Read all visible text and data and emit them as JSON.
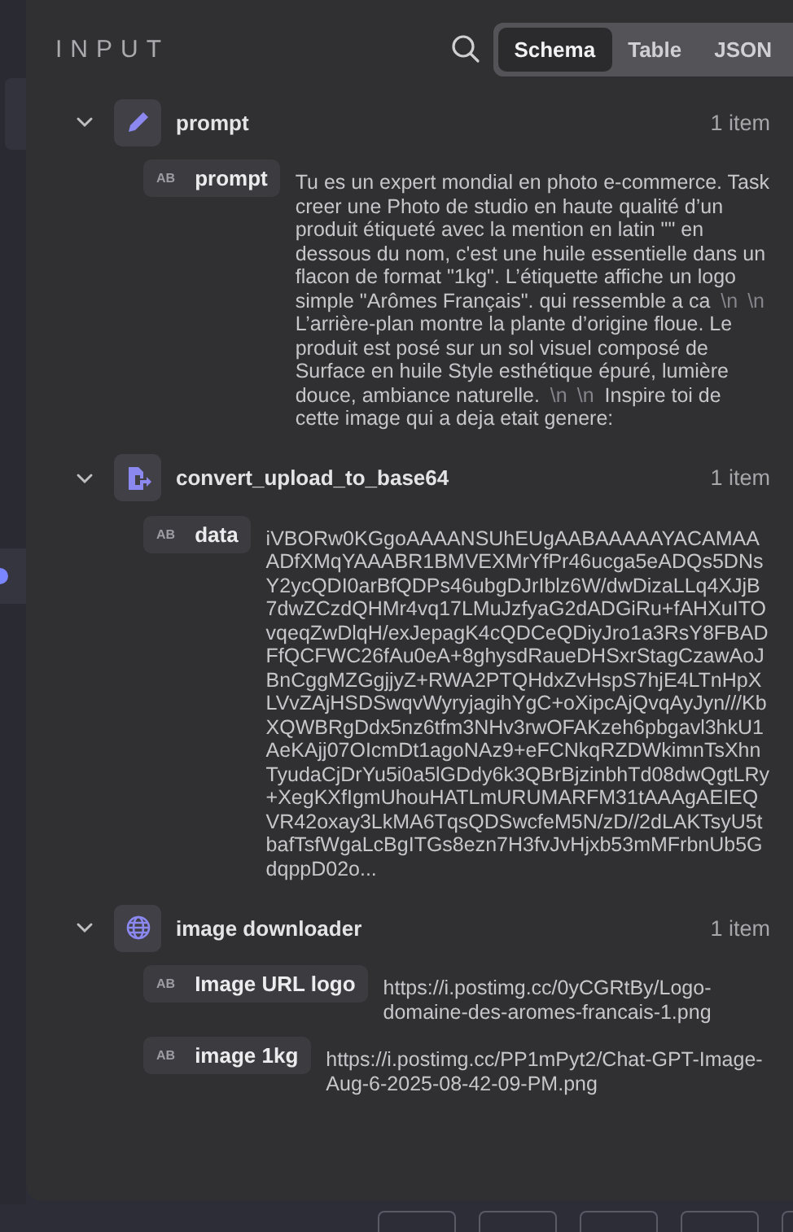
{
  "panel": {
    "title": "INPUT"
  },
  "view_tabs": [
    {
      "label": "Schema",
      "selected": true
    },
    {
      "label": "Table",
      "selected": false
    },
    {
      "label": "JSON",
      "selected": false
    }
  ],
  "nodes": [
    {
      "name": "prompt",
      "expanded": true,
      "count": "1 item",
      "fields": [
        {
          "badge": "AB",
          "name": "prompt",
          "value": [
            {
              "kind": "text",
              "text": "Tu es un expert mondial en photo e-commerce. Task creer une Photo de studio en haute qualité d’un produit étiqueté avec la mention en latin \"\" en dessous du nom, c'est une huile essentielle dans un flacon de format \"1kg\". L’étiquette affiche un logo simple \"Arômes Français\". qui ressemble a ca "
            },
            {
              "kind": "escape",
              "text": "\\n"
            },
            {
              "kind": "escape",
              "text": "\\n"
            },
            {
              "kind": "text",
              "text": " L’arrière-plan montre la plante d’origine floue. Le produit est posé sur un sol visuel composé de Surface en huile Style esthétique épuré, lumière douce, ambiance naturelle. "
            },
            {
              "kind": "escape",
              "text": "\\n"
            },
            {
              "kind": "escape",
              "text": "\\n"
            },
            {
              "kind": "text",
              "text": " Inspire toi de cette image qui a deja etait genere:"
            }
          ]
        }
      ]
    },
    {
      "name": "convert_upload_to_base64",
      "expanded": true,
      "count": "1 item",
      "fields": [
        {
          "badge": "AB",
          "name": "data",
          "value": [
            {
              "kind": "text",
              "text": "iVBORw0KGgoAAAANSUhEUgAABAAAAAYACAMAAADfXMqYAAABR1BMVEXMrYfPr46ucga5eADQs5DNsY2ycQDI0arBfQDPs46ubgDJrIblz6W/dwDizaLLq4XJjB7dwZCzdQHMr4vq17LMuJzfyaG2dADGiRu+fAHXuITOvqeqZwDlqH/exJepagK4cQDCeQDiyJro1a3RsY8FBADFfQCFWC26fAu0eA+8ghysdRaueDHSxrStagCzawAoJBnCggMZGgjjyZ+RWA2PTQHdxZvHspS7hjE4LTnHpXLVvZAjHSDSwqvWyryjagihYgC+oXipcAjQvqAyJyn///KbXQWBRgDdx5nz6tfm3NHv3rwOFAKzeh6pbgavl3hkU1AeKAjj07OIcmDt1agoNAz9+eFCNkqRZDWkimnTsXhnTyudaCjDrYu5i0a5lGDdy6k3QBrBjzinbhTd08dwQgtLRy+XegKXfIgmUhouHATLmURUMARFM31tAAAgAEIEQVR42oxay3LkMA6TqsQDSwcfeM5N/zD//2dLAKTsyU5tbafTsfWgaLcBgITGs8ezn7H3fvJvHjxb53mMFrbnUb5GdqppD02o..."
            }
          ]
        }
      ]
    },
    {
      "name": "image downloader",
      "expanded": true,
      "count": "1 item",
      "fields": [
        {
          "badge": "AB",
          "name": "Image URL logo",
          "value": [
            {
              "kind": "text",
              "text": "https://i.postimg.cc/0yCGRtBy/Logo-domaine-des-aromes-francais-1.png"
            }
          ]
        },
        {
          "badge": "AB",
          "name": "image 1kg",
          "value": [
            {
              "kind": "text",
              "text": "https://i.postimg.cc/PP1mPyt2/Chat-GPT-Image-Aug-6-2025-08-42-09-PM.png"
            }
          ]
        }
      ]
    }
  ]
}
